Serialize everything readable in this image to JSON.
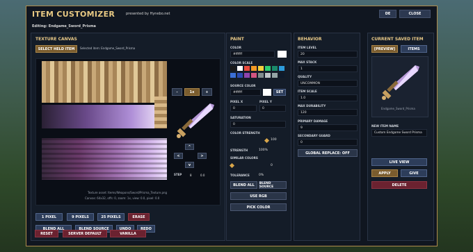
{
  "header": {
    "title": "ITEM CUSTOMIZER",
    "presented": "presented by Hynebo.net",
    "editing": "Editing: Endgame_Sword_Prisma",
    "lang_button": "DE",
    "close_button": "CLOSE"
  },
  "texture": {
    "heading": "TEXTURE CANVAS",
    "select_button": "SELECT HELD ITEM",
    "selected_text": "Selected item: Endgame_Sword_Prisma",
    "zoom_minus": "-",
    "zoom_value": "1x",
    "zoom_plus": "+",
    "arrow_up": "^",
    "arrow_left": "<",
    "arrow_right": ">",
    "arrow_down": "v",
    "step_label": "STEP",
    "step_value": "8",
    "step_extra": "0.0",
    "asset_info": "Texture asset: Items/Weapons/Sword/Prisma_Texture.png",
    "canvas_info": "Canvas: 64x32, offs: 0, zoom: 1x, view: 0.0, pixel: 0.0",
    "tools": [
      "1 PIXEL",
      "9 PIXELS",
      "25 PIXELS",
      "ERASE"
    ],
    "actions": [
      "BLEND ALL",
      "BLEND SOURCE",
      "UNDO",
      "REDO"
    ],
    "resets": [
      "RESET",
      "SERVER DEFAULT",
      "VANILLA"
    ]
  },
  "paint": {
    "heading": "PAINT",
    "color_label": "COLOR",
    "color_value": "#ffffff",
    "scale_label": "COLOR SCALE",
    "scale_colors": [
      "#1a1a1a",
      "#ffffff",
      "#e84a3c",
      "#f39a24",
      "#f4d03f",
      "#2ecc71",
      "#1a8a6a",
      "#2d9cdb",
      "#3b6fd6",
      "#2a4ab0",
      "#8e44ad",
      "#d35480",
      "#7f8c8d",
      "#bdc3c7",
      "#95a5a6",
      "#0f1a2a"
    ],
    "source_label": "SOURCE COLOR",
    "source_value": "#ffffff",
    "set_button": "SET",
    "pixel_x_label": "PIXEL X",
    "pixel_x": "0",
    "pixel_y_label": "PIXEL Y",
    "pixel_y": "0",
    "saturation_label": "SATURATION",
    "saturation": "0",
    "strength_label": "COLOR STRENGTH",
    "strength": "100",
    "strength_label2": "STRENGTH",
    "strength_pct": "100%",
    "similar_label": "SIMILAR COLORS",
    "similar": "0",
    "tolerance_label": "TOLERANCE",
    "tolerance": "0%",
    "blend_all": "BLEND ALL",
    "blend_source": "BLEND SOURCE",
    "use_rgb": "USE RGB",
    "pick_color": "PICK COLOR"
  },
  "behavior": {
    "heading": "BEHAVIOR",
    "item_level_label": "ITEM LEVEL",
    "item_level": "20",
    "max_stack_label": "MAX STACK",
    "max_stack": "1",
    "quality_label": "QUALITY",
    "quality": "UNCOMMON",
    "item_scale_label": "ITEM SCALE",
    "item_scale": "1.0",
    "max_durability_label": "MAX DURABILITY",
    "max_durability": "120",
    "primary_damage_label": "PRIMARY DAMAGE",
    "primary_damage": "9",
    "secondary_guard_label": "SECONDARY GUARD",
    "secondary_guard": "0",
    "global_replace": "GLOBAL REPLACE: OFF"
  },
  "current": {
    "heading": "CURRENT SAVED ITEM",
    "preview_tab": "[PREVIEW]",
    "items_tab": "ITEMS",
    "preview_caption": "Endgame_Sword_Prisma",
    "new_name_label": "NEW ITEM NAME",
    "new_name": "Custom Endgame Sword Prisma",
    "live_view": "LIVE VIEW",
    "apply": "APPLY",
    "give": "GIVE",
    "delete": "DELETE"
  }
}
